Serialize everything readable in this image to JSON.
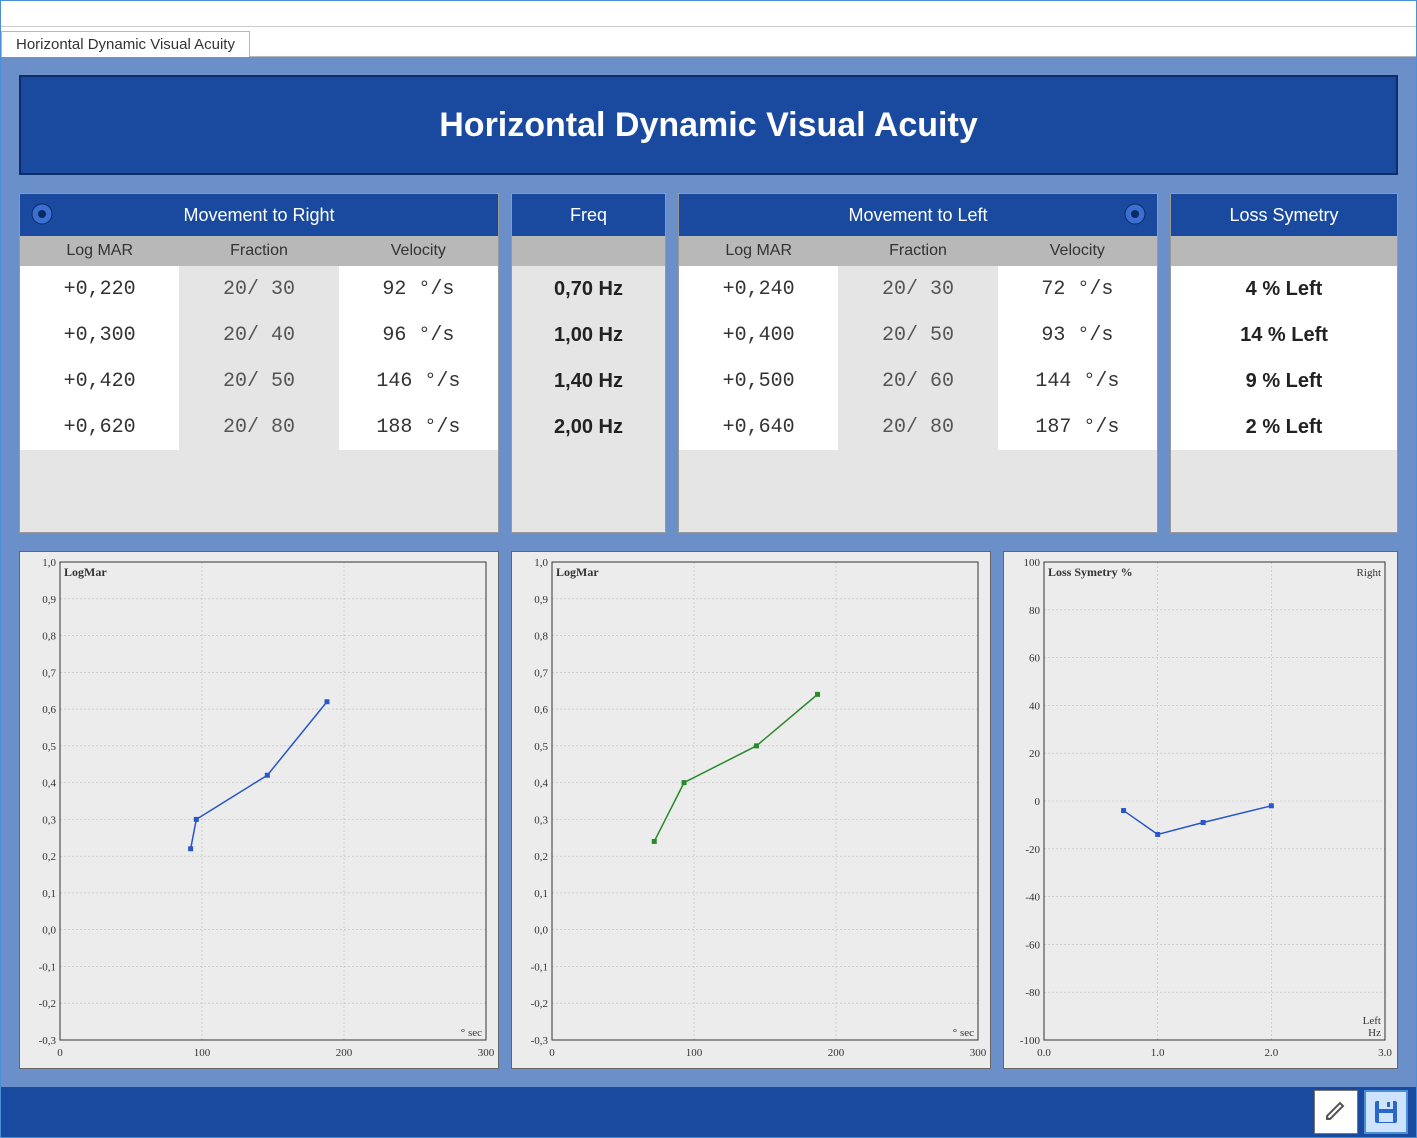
{
  "tab": {
    "label": "Horizontal Dynamic Visual Acuity"
  },
  "header": {
    "title": "Horizontal Dynamic Visual Acuity"
  },
  "sections": {
    "right": {
      "title": "Movement to Right",
      "cols": [
        "Log MAR",
        "Fraction",
        "Velocity"
      ]
    },
    "freq": {
      "title": "Freq"
    },
    "left": {
      "title": "Movement to Left",
      "cols": [
        "Log MAR",
        "Fraction",
        "Velocity"
      ]
    },
    "sym": {
      "title": "Loss Symetry"
    }
  },
  "rows": [
    {
      "r_logmar": "+0,220",
      "r_frac": "20/ 30",
      "r_vel": "92 °/s",
      "freq": "0,70 Hz",
      "l_logmar": "+0,240",
      "l_frac": "20/ 30",
      "l_vel": "72 °/s",
      "sym": "4 % Left"
    },
    {
      "r_logmar": "+0,300",
      "r_frac": "20/ 40",
      "r_vel": "96 °/s",
      "freq": "1,00 Hz",
      "l_logmar": "+0,400",
      "l_frac": "20/ 50",
      "l_vel": "93 °/s",
      "sym": "14 % Left"
    },
    {
      "r_logmar": "+0,420",
      "r_frac": "20/ 50",
      "r_vel": "146 °/s",
      "freq": "1,40 Hz",
      "l_logmar": "+0,500",
      "l_frac": "20/ 60",
      "l_vel": "144 °/s",
      "sym": "9 % Left"
    },
    {
      "r_logmar": "+0,620",
      "r_frac": "20/ 80",
      "r_vel": "188 °/s",
      "freq": "2,00 Hz",
      "l_logmar": "+0,640",
      "l_frac": "20/ 80",
      "l_vel": "187 °/s",
      "sym": "2 % Left"
    }
  ],
  "chart_data": [
    {
      "id": "chart-right",
      "type": "line",
      "title": "LogMar",
      "xlabel": "° sec",
      "x": [
        92,
        96,
        146,
        188
      ],
      "y": [
        0.22,
        0.3,
        0.42,
        0.62
      ],
      "xlim": [
        0,
        300
      ],
      "ylim": [
        -0.3,
        1.0
      ],
      "xticks": [
        0,
        100,
        200,
        300
      ],
      "yticks": [
        -0.3,
        -0.2,
        -0.1,
        0.0,
        0.1,
        0.2,
        0.3,
        0.4,
        0.5,
        0.6,
        0.7,
        0.8,
        0.9,
        1.0
      ],
      "color": "#2a56c7"
    },
    {
      "id": "chart-left",
      "type": "line",
      "title": "LogMar",
      "xlabel": "° sec",
      "x": [
        72,
        93,
        144,
        187
      ],
      "y": [
        0.24,
        0.4,
        0.5,
        0.64
      ],
      "xlim": [
        0,
        300
      ],
      "ylim": [
        -0.3,
        1.0
      ],
      "xticks": [
        0,
        100,
        200,
        300
      ],
      "yticks": [
        -0.3,
        -0.2,
        -0.1,
        0.0,
        0.1,
        0.2,
        0.3,
        0.4,
        0.5,
        0.6,
        0.7,
        0.8,
        0.9,
        1.0
      ],
      "color": "#2a8a2a"
    },
    {
      "id": "chart-sym",
      "type": "line",
      "title": "Loss Symetry %",
      "corner_tr": "Right",
      "corner_br": "Left",
      "xlabel": "Hz",
      "x": [
        0.7,
        1.0,
        1.4,
        2.0
      ],
      "y": [
        -4,
        -14,
        -9,
        -2
      ],
      "xlim": [
        0.0,
        3.0
      ],
      "ylim": [
        -100,
        100
      ],
      "xticks": [
        0.0,
        1.0,
        2.0,
        3.0
      ],
      "yticks": [
        -100,
        -80,
        -60,
        -40,
        -20,
        0,
        20,
        40,
        60,
        80,
        100
      ],
      "color": "#2a56c7"
    }
  ],
  "buttons": {
    "edit": "edit",
    "save": "save"
  }
}
